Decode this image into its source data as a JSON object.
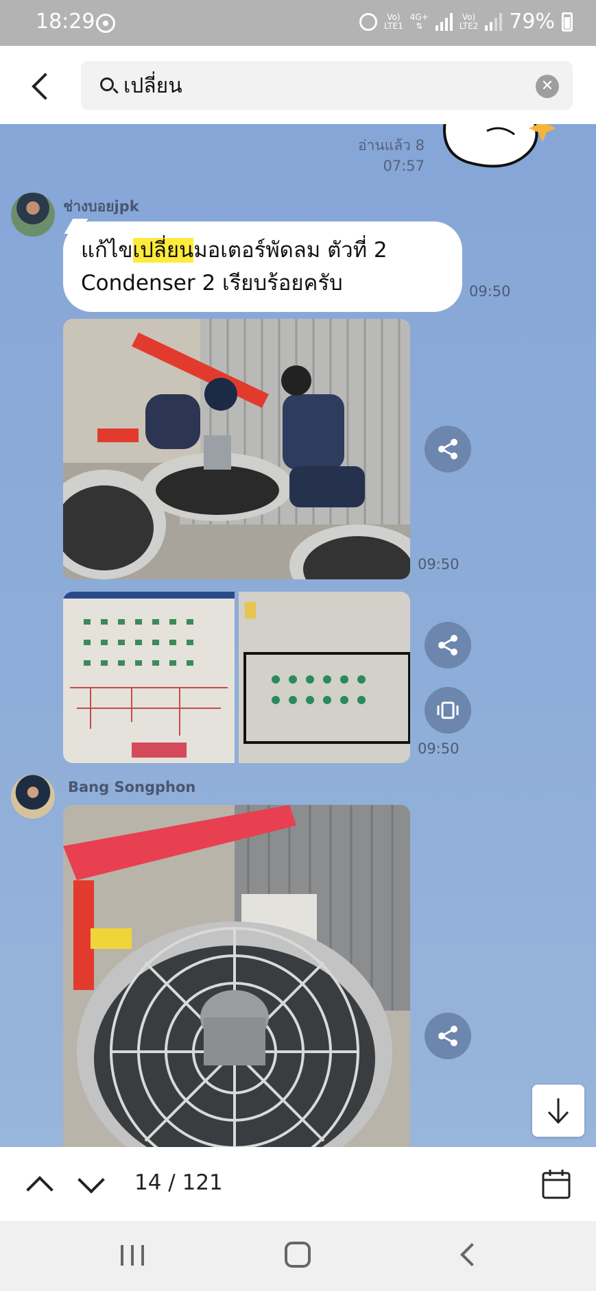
{
  "status_bar": {
    "time": "18:29",
    "battery": "79%",
    "sim1_top": "Vo)",
    "sim1_bottom": "LTE1",
    "network": "4G+",
    "sim2_top": "Vo)",
    "sim2_bottom": "LTE2"
  },
  "search": {
    "query": "เปลี่ยน",
    "clear_icon": "clear-icon"
  },
  "chat": {
    "read_receipt": "อ่านแล้ว 8",
    "read_time": "07:57",
    "messages": [
      {
        "sender": "ช่างบอยjpk",
        "text_before": "แก้ไข",
        "text_highlight": "เปลี่ยน",
        "text_after": "มอเตอร์พัดลม ตัวที่ 2 Condenser 2 เรียบร้อยครับ",
        "time": "09:50"
      },
      {
        "type": "photo",
        "time": "09:50"
      },
      {
        "type": "photo-album",
        "time": "09:50",
        "photo_count": 2
      },
      {
        "sender": "Bang Songphon",
        "type": "photo"
      }
    ]
  },
  "footer": {
    "counter": "14 / 121"
  },
  "colors": {
    "chat_background": "#8aaad6",
    "highlight": "#ffeb3b",
    "status_bar": "#b3b3b3"
  }
}
